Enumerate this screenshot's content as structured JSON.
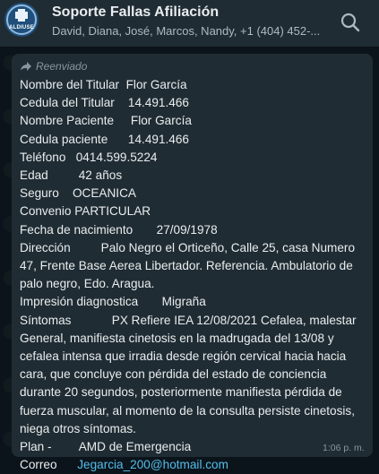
{
  "header": {
    "title": "Soporte Fallas Afiliación",
    "members": "David, Diana, José, Marcos, Nandy, +1 (404) 452-...",
    "avatar_text": "ALDIUSE",
    "search_icon": "search-icon"
  },
  "message": {
    "forwarded_label": "Reenviado",
    "forward_icon": "forward-arrow-icon",
    "lines": [
      {
        "label": "Nombre del Titular",
        "value": "Flor García"
      },
      {
        "label": "Cedula del Titular",
        "value": "14.491.466"
      },
      {
        "label": "Nombre Paciente",
        "value": "Flor García"
      },
      {
        "label": "Cedula  paciente",
        "value": "14.491.466"
      },
      {
        "label": "Teléfono",
        "value": "0414.599.5224"
      },
      {
        "label": "Edad",
        "value": "42 años"
      },
      {
        "label": "Seguro",
        "value": "OCEANICA"
      },
      {
        "label": "Convenio",
        "value": "PARTICULAR"
      },
      {
        "label": "Fecha de nacimiento",
        "value": "27/09/1978"
      },
      {
        "label": "Dirección",
        "value": "Palo Negro el Orticeño, Calle 25, casa Numero 47, Frente Base Aerea Libertador. Referencia. Ambulatorio de palo negro, Edo. Aragua."
      },
      {
        "label": "Impresión diagnostica",
        "value": "Migraña"
      },
      {
        "label": "Síntomas",
        "value": "PX Refiere IEA 12/08/2021 Cefalea, malestar General, manifiesta cinetosis en la madrugada del 13/08 y cefalea intensa que irradia desde región cervical hacia hacia cara, que concluye con pérdida del estado de conciencia durante 20 segundos, posteriormente manifiesta pérdida de fuerza muscular, al momento de la consulta persiste cinetosis, niega otros síntomas."
      },
      {
        "label": "Plan -",
        "value": "AMD de Emergencia"
      },
      {
        "label": "Correo",
        "value": "Jegarcia_200@hotmail.com"
      }
    ],
    "time": "1:06 p. m.",
    "link_color": "#53bdeb"
  }
}
